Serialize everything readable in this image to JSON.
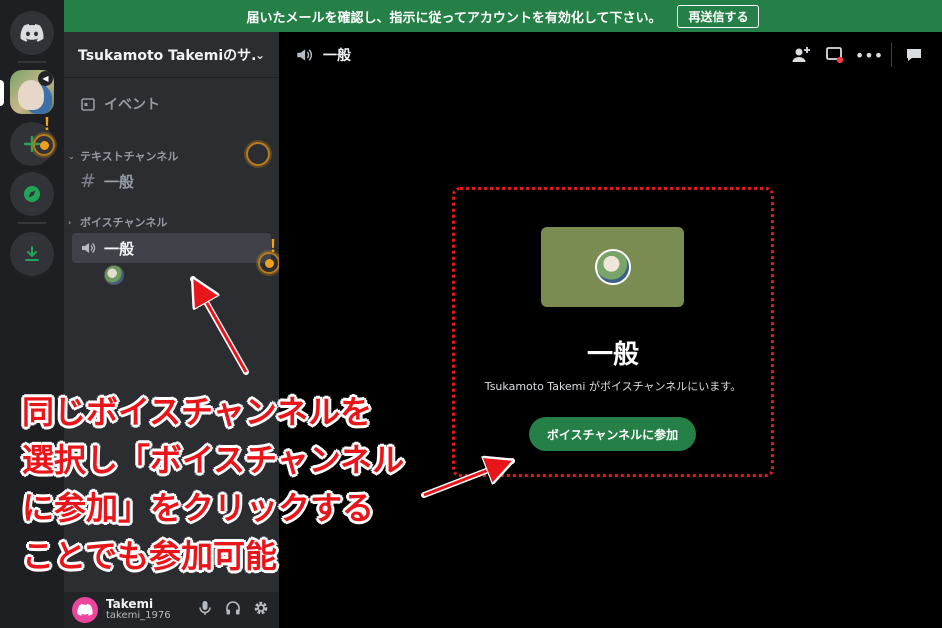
{
  "banner": {
    "message": "届いたメールを確認し、指示に従ってアカウントを有効化して下さい。",
    "resend_label": "再送信する"
  },
  "rail": {
    "icons": [
      "discord-logo-icon",
      "server-icon",
      "add-server-icon",
      "explore-icon",
      "download-icon"
    ]
  },
  "sidebar": {
    "server_name": "Tsukamoto Takemiのサ...",
    "events_label": "イベント",
    "text_category": "テキストチャンネル",
    "text_channel": "一般",
    "voice_category": "ボイスチャンネル",
    "voice_channel": "一般"
  },
  "user_panel": {
    "name": "Takemi",
    "tag": "takemi_1976"
  },
  "main": {
    "channel_title": "一般",
    "voice_title": "一般",
    "voice_desc": "Tsukamoto Takemi がボイスチャンネルにいます。",
    "join_label": "ボイスチャンネルに参加"
  },
  "annotation": {
    "line1": "同じボイスチャンネルを",
    "line2": "選択し「ボイスチャンネル",
    "line3": "に参加」をクリックする",
    "line4": "ことでも参加可能"
  },
  "colors": {
    "accent_green": "#248046",
    "annotation_red": "#e8161a",
    "sidebar_bg": "#2b2d31",
    "rail_bg": "#1e1f22"
  }
}
